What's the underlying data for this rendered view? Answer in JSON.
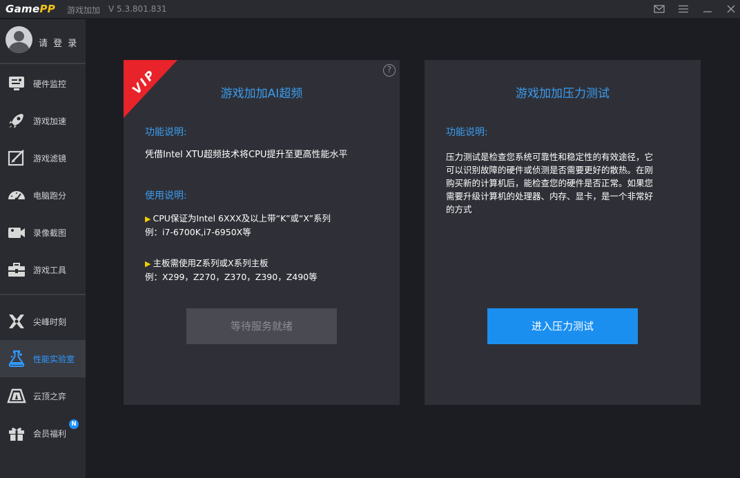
{
  "titlebar": {
    "logo_main": "Game",
    "logo_accent": "PP",
    "app_name": "游戏加加",
    "version": "V 5.3.801.831",
    "icons": [
      "mail-icon",
      "menu-icon",
      "minimize-icon",
      "close-icon"
    ]
  },
  "user": {
    "login_label": "请 登 录"
  },
  "sidebar": {
    "items": [
      {
        "label": "硬件监控",
        "icon": "hardware-monitor-icon"
      },
      {
        "label": "游戏加速",
        "icon": "rocket-icon"
      },
      {
        "label": "游戏滤镜",
        "icon": "filter-icon"
      },
      {
        "label": "电脑跑分",
        "icon": "speedometer-icon"
      },
      {
        "label": "录像截图",
        "icon": "camera-icon"
      },
      {
        "label": "游戏工具",
        "icon": "toolbox-icon"
      },
      {
        "label": "尖峰时刻",
        "icon": "highlight-icon"
      },
      {
        "label": "性能实验室",
        "icon": "flask-icon",
        "active": true
      },
      {
        "label": "云顶之弈",
        "icon": "tft-icon"
      },
      {
        "label": "会员福利",
        "icon": "gift-icon",
        "badge": "N"
      }
    ]
  },
  "left_panel": {
    "badge": "VIP",
    "title": "游戏加加AI超频",
    "feature_label": "功能说明:",
    "feature_text": "凭借Intel XTU超频技术将CPU提升至更高性能水平",
    "usage_label": "使用说明:",
    "usage_1_line1": "CPU保证为Intel 6XXX及以上带“K”或“X”系列",
    "usage_1_line2": "例：i7-6700K,i7-6950X等",
    "usage_2_line1": "主板需使用Z系列或X系列主板",
    "usage_2_line2": "例：X299，Z270，Z370，Z390，Z490等",
    "button": "等待服务就绪"
  },
  "right_panel": {
    "title": "游戏加加压力测试",
    "feature_label": "功能说明:",
    "lines": [
      "压力测试是检查您系统可靠性和稳定性的有效途径，它",
      "可以识别故障的硬件或侦测是否需要更好的散热。在刚",
      "购买新的计算机后，能检查您的硬件是否正常。如果您",
      "需要升级计算机的处理器、内存、显卡，是一个非常好",
      "的方式"
    ],
    "button": "进入压力测试"
  },
  "colors": {
    "accent_blue": "#3a9cf0",
    "button_blue": "#1b8ff0",
    "vip_red": "#e8232a",
    "arrow_yellow": "#f5d000"
  }
}
